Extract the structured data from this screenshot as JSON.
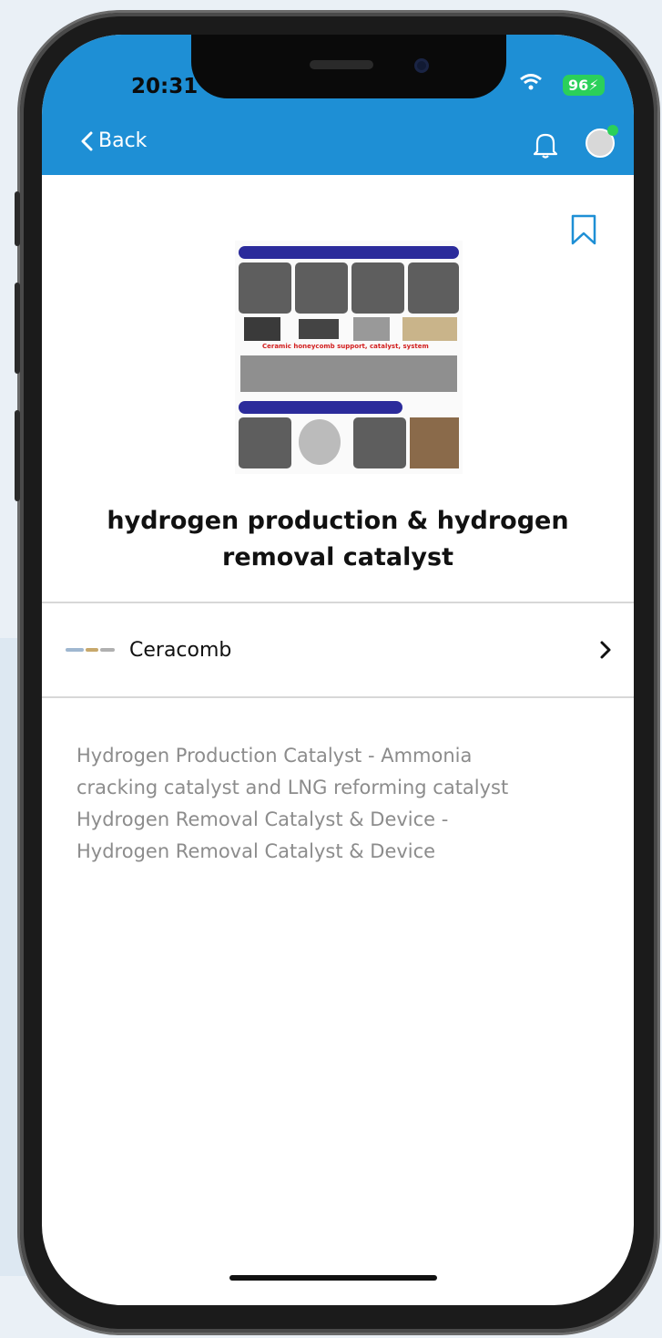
{
  "status_bar": {
    "time": "20:31",
    "battery": "96"
  },
  "nav": {
    "back_label": "Back"
  },
  "product": {
    "title": "hydrogen production & hydrogen removal catalyst",
    "image_caption": "Ceramic honeycomb support, catalyst, system"
  },
  "company": {
    "name": "Ceracomb"
  },
  "description": {
    "lines": [
      "Hydrogen Production Catalyst - Ammonia",
      "cracking catalyst and LNG reforming catalyst",
      "Hydrogen Removal Catalyst & Device -",
      "Hydrogen Removal Catalyst & Device"
    ]
  },
  "colors": {
    "accent": "#1e8fd5",
    "battery": "#2bd05a"
  }
}
